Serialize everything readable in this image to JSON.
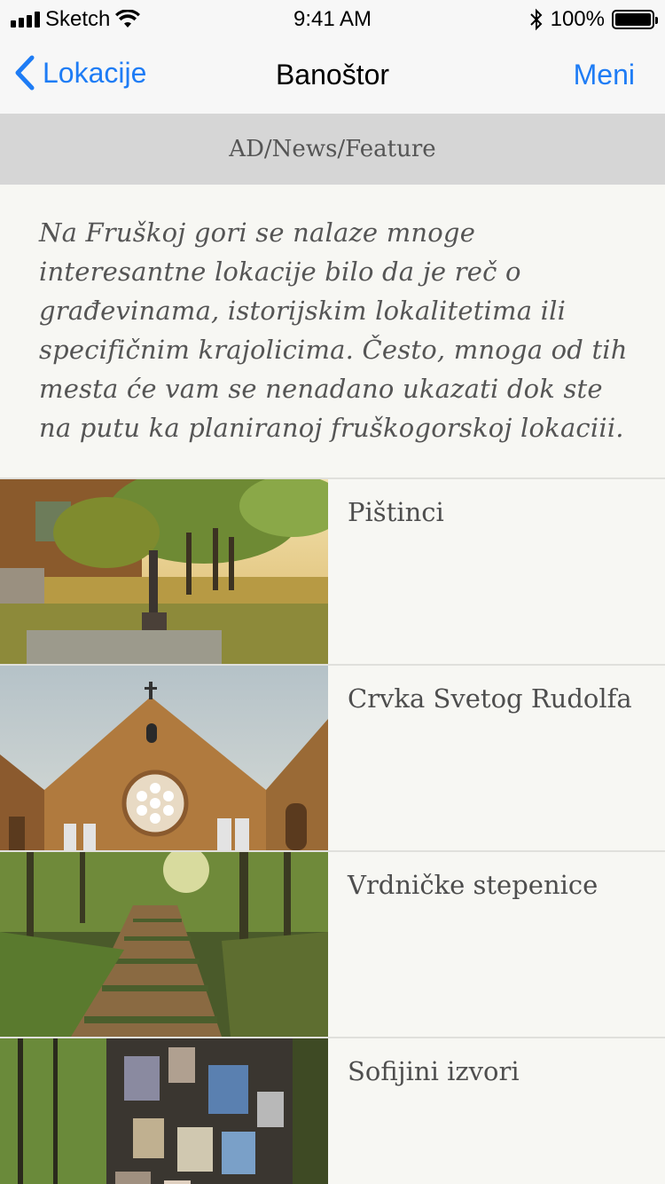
{
  "status": {
    "carrier": "Sketch",
    "time": "9:41 AM",
    "battery": "100%"
  },
  "nav": {
    "back_label": "Lokacije",
    "title": "Banoštor",
    "menu_label": "Meni"
  },
  "ad": {
    "label": "AD/News/Feature"
  },
  "intro": {
    "text": "Na Fruškoj gori se nalaze mnoge interesantne lokacije bilo da je reč o građevinama, istorijskim lokalitetima ili specifičnim krajolicima. Često, mnoga od tih mesta će vam se nenadano ukazati dok ste na putu ka planiranoj fruškogorskoj lokaciii."
  },
  "locations": [
    {
      "label": "Pištinci",
      "image": "village-water-pump-photo"
    },
    {
      "label": "Crvka Svetog Rudolfa",
      "image": "ruined-church-photo"
    },
    {
      "label": "Vrdničke stepenice",
      "image": "forest-stairs-photo"
    },
    {
      "label": "Sofijini izvori",
      "image": "tree-with-icons-photo"
    }
  ]
}
